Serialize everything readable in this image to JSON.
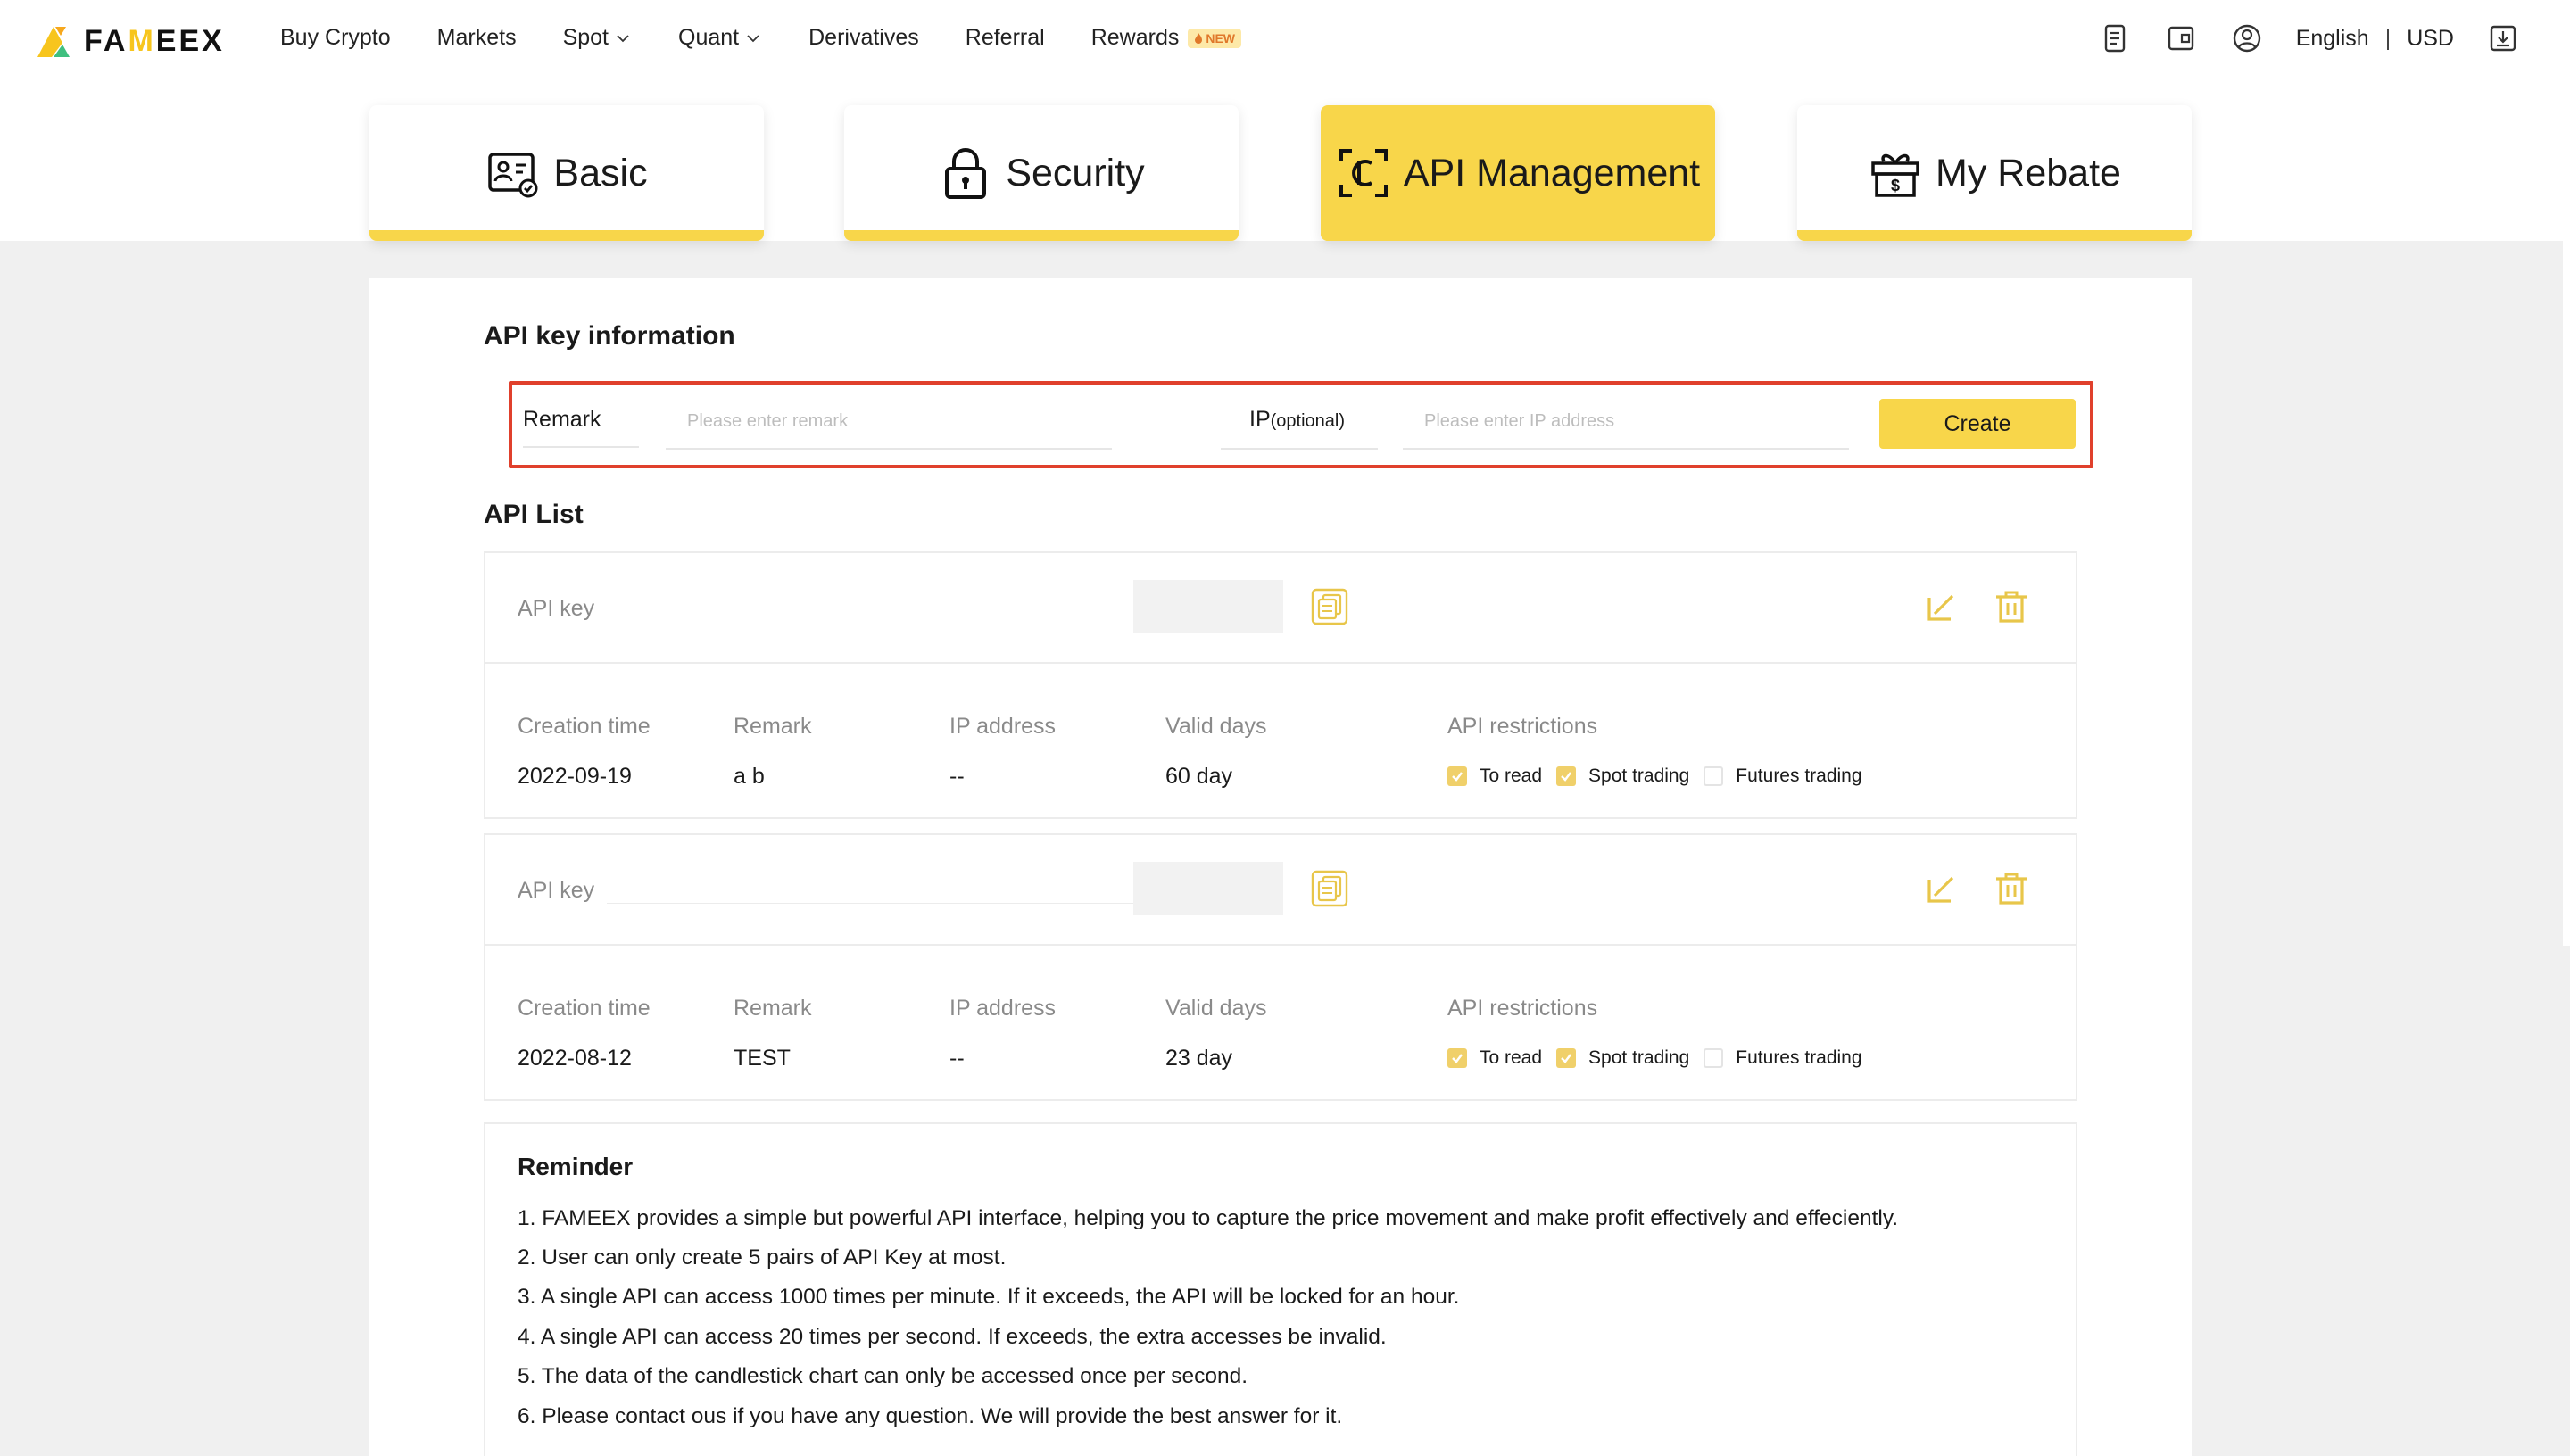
{
  "header": {
    "logo_text_pre": "FA",
    "logo_text_acc": "M",
    "logo_text_post": "EEX",
    "nav": [
      {
        "label": "Buy Crypto",
        "dropdown": false
      },
      {
        "label": "Markets",
        "dropdown": false
      },
      {
        "label": "Spot",
        "dropdown": true
      },
      {
        "label": "Quant",
        "dropdown": true
      },
      {
        "label": "Derivatives",
        "dropdown": false
      },
      {
        "label": "Referral",
        "dropdown": false
      },
      {
        "label": "Rewards",
        "dropdown": false
      }
    ],
    "rewards_badge": "NEW",
    "language": "English",
    "separator": "|",
    "currency": "USD",
    "icons": [
      "orders-icon",
      "wallet-icon",
      "user-icon",
      "download-icon"
    ]
  },
  "tabs": [
    {
      "label": "Basic",
      "icon": "id-card-icon",
      "active": false
    },
    {
      "label": "Security",
      "icon": "lock-icon",
      "active": true
    },
    {
      "label": "API Management",
      "icon": "api-icon",
      "active": true
    },
    {
      "label": "My Rebate",
      "icon": "gift-icon",
      "active": false
    }
  ],
  "create": {
    "section_title": "API key information",
    "remark_label": "Remark",
    "remark_placeholder": "Please enter remark",
    "ip_label": "IP",
    "ip_label_suffix": "(optional)",
    "ip_placeholder": "Please enter IP address",
    "create_button": "Create"
  },
  "api_list": {
    "title": "API List",
    "key_label": "API key",
    "headers": {
      "creation_time": "Creation time",
      "remark": "Remark",
      "ip_address": "IP address",
      "valid_days": "Valid days",
      "restrictions": "API restrictions"
    },
    "restriction_labels": [
      "To read",
      "Spot trading",
      "Futures trading"
    ],
    "items": [
      {
        "creation_time": "2022-09-19",
        "remark": "a b",
        "ip_address": "--",
        "valid_days": "60 day",
        "restrictions": [
          true,
          true,
          false
        ]
      },
      {
        "creation_time": "2022-08-12",
        "remark": "TEST",
        "ip_address": "--",
        "valid_days": "23 day",
        "restrictions": [
          true,
          true,
          false
        ]
      }
    ]
  },
  "reminder": {
    "title": "Reminder",
    "lines": [
      "1. FAMEEX provides a simple but powerful API interface, helping you to capture the price movement and make profit effectively and effeciently.",
      "2. User can only create 5 pairs of API Key at most.",
      "3. A single API can access 1000 times per minute. If it exceeds, the API will be locked for an hour.",
      "4. A single API can access 20 times per second. If exceeds, the extra accesses be invalid.",
      "5. The data of the candlestick chart can only be accessed once per second.",
      "6. Please contact ous if you have any question. We will provide the best answer for it."
    ]
  },
  "colors": {
    "accent": "#f8d64a",
    "highlight_border": "#e0402c",
    "page_bg": "#f0f0f0"
  }
}
